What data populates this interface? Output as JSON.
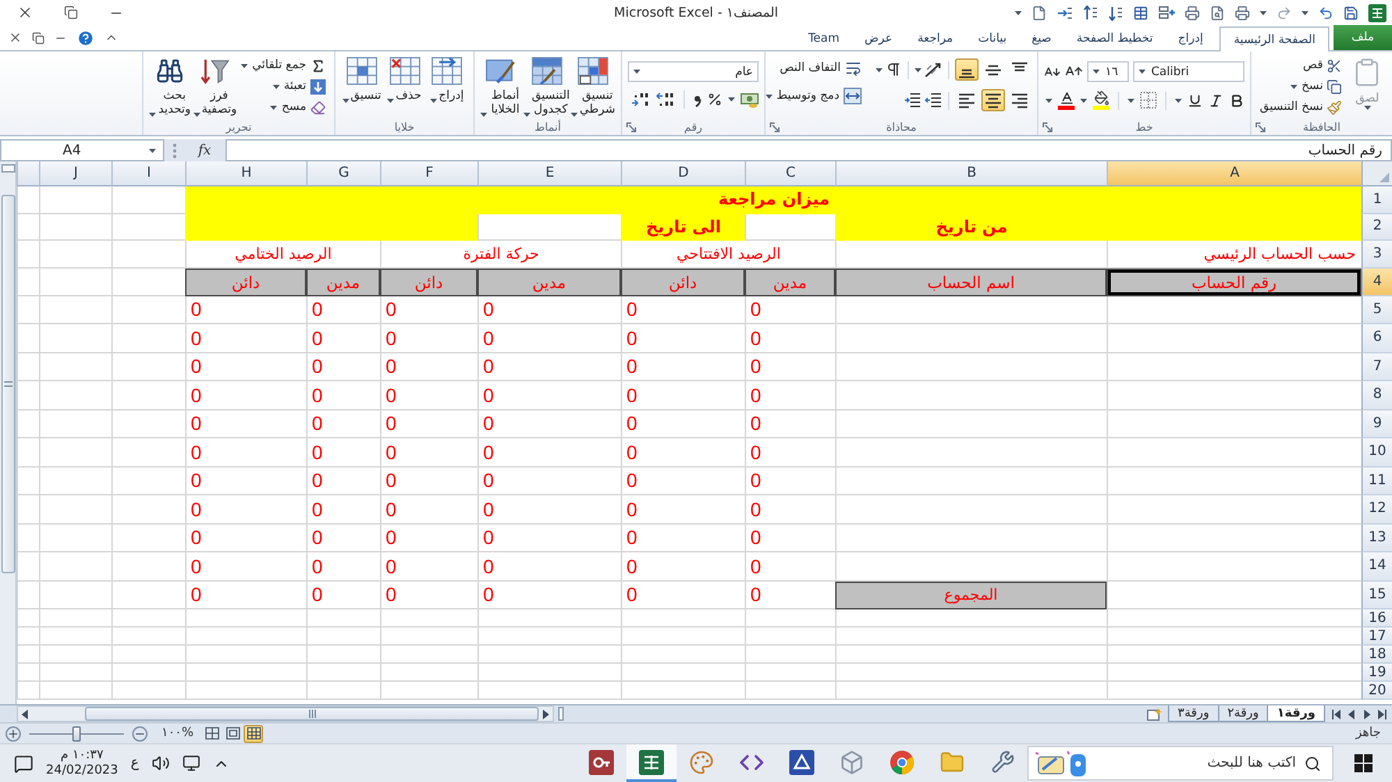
{
  "window": {
    "title": "المصنف١ - Microsoft Excel"
  },
  "ribbon_tabs": [
    {
      "label": "ملف",
      "kind": "file",
      "selected": false
    },
    {
      "label": "الصفحة الرئيسية",
      "kind": "tab",
      "selected": true
    },
    {
      "label": "إدراج",
      "kind": "tab",
      "selected": false
    },
    {
      "label": "تخطيط الصفحة",
      "kind": "tab",
      "selected": false
    },
    {
      "label": "صيغ",
      "kind": "tab",
      "selected": false
    },
    {
      "label": "بيانات",
      "kind": "tab",
      "selected": false
    },
    {
      "label": "مراجعة",
      "kind": "tab",
      "selected": false
    },
    {
      "label": "عرض",
      "kind": "tab",
      "selected": false
    },
    {
      "label": "Team",
      "kind": "tab",
      "selected": false
    }
  ],
  "ribbon": {
    "clipboard": {
      "label": "الحافظة",
      "paste": {
        "label": "لصق",
        "disabled": true
      },
      "cut": "قص",
      "copy": "نسخ",
      "format_painter": "نسخ التنسيق"
    },
    "font": {
      "label": "خط",
      "font_name": "Calibri",
      "font_size": "١٦"
    },
    "alignment": {
      "label": "محاذاة",
      "vertical": [
        {
          "kind": "top",
          "selected": false
        },
        {
          "kind": "middle",
          "selected": false
        },
        {
          "kind": "bottom",
          "selected": true
        }
      ],
      "horizontal": [
        {
          "kind": "right",
          "selected": false
        },
        {
          "kind": "center",
          "selected": true
        },
        {
          "kind": "left",
          "selected": false
        }
      ],
      "wrap_text": "التفاف النص",
      "merge_center": "دمج وتوسيط"
    },
    "number": {
      "label": "رقم",
      "format": "عام"
    },
    "styles": {
      "label": "أنماط",
      "buttons": [
        {
          "label": "تنسيق شرطي",
          "kind": "conditional"
        },
        {
          "label": "التنسيق كجدول",
          "kind": "table"
        },
        {
          "label": "أنماط الخلايا",
          "kind": "cell_styles"
        }
      ]
    },
    "cells": {
      "label": "خلايا",
      "buttons": [
        {
          "label": "إدراج",
          "kind": "insert"
        },
        {
          "label": "حذف",
          "kind": "delete"
        },
        {
          "label": "تنسيق",
          "kind": "format"
        }
      ]
    },
    "editing": {
      "label": "تحرير",
      "autosum": "جمع تلقائي",
      "fill": "تعبئة",
      "clear": "مسح",
      "sort_filter": "فرز وتصفية",
      "find_select": "بحث وتحديد"
    }
  },
  "formula_bar": {
    "name_box": "A4",
    "function_label": "fx",
    "content": "رقم الحساب"
  },
  "sheet": {
    "columns": [
      {
        "label": "A",
        "selected": true
      },
      {
        "label": "B",
        "selected": false
      },
      {
        "label": "C",
        "selected": false
      },
      {
        "label": "D",
        "selected": false
      },
      {
        "label": "E",
        "selected": false
      },
      {
        "label": "F",
        "selected": false
      },
      {
        "label": "G",
        "selected": false
      },
      {
        "label": "H",
        "selected": false
      },
      {
        "label": "I",
        "selected": false
      },
      {
        "label": "J",
        "selected": false
      }
    ],
    "rows": [
      {
        "label": "1",
        "selected": false
      },
      {
        "label": "2",
        "selected": false
      },
      {
        "label": "3",
        "selected": false
      },
      {
        "label": "4",
        "selected": true
      },
      {
        "label": "5",
        "selected": false
      },
      {
        "label": "6",
        "selected": false
      },
      {
        "label": "7",
        "selected": false
      },
      {
        "label": "8",
        "selected": false
      },
      {
        "label": "9",
        "selected": false
      },
      {
        "label": "10",
        "selected": false
      },
      {
        "label": "11",
        "selected": false
      },
      {
        "label": "12",
        "selected": false
      },
      {
        "label": "13",
        "selected": false
      },
      {
        "label": "14",
        "selected": false
      },
      {
        "label": "15",
        "selected": false
      },
      {
        "label": "16",
        "selected": false
      },
      {
        "label": "17",
        "selected": false
      },
      {
        "label": "18",
        "selected": false
      },
      {
        "label": "19",
        "selected": false
      },
      {
        "label": "20",
        "selected": false
      }
    ],
    "title": "ميزان مراجعة",
    "from_label": "من تاريخ",
    "to_label": "الى تاريخ",
    "account_group": "حسب الحساب الرئيسي",
    "column_groups": [
      "الرصيد الافتتاحي",
      "حركة الفترة",
      "الرصيد الختامي"
    ],
    "headers": [
      {
        "text": "رقم الحساب",
        "selected": true
      },
      {
        "text": "اسم الحساب",
        "selected": false
      },
      {
        "text": "مدين",
        "selected": false
      },
      {
        "text": "دائن",
        "selected": false
      },
      {
        "text": "مدين",
        "selected": false
      },
      {
        "text": "دائن",
        "selected": false
      },
      {
        "text": "مدين",
        "selected": false
      },
      {
        "text": "دائن",
        "selected": false
      }
    ],
    "data_rows": [
      {
        "values": [
          "0",
          "0",
          "0",
          "0",
          "0",
          "0"
        ]
      },
      {
        "values": [
          "0",
          "0",
          "0",
          "0",
          "0",
          "0"
        ]
      },
      {
        "values": [
          "0",
          "0",
          "0",
          "0",
          "0",
          "0"
        ]
      },
      {
        "values": [
          "0",
          "0",
          "0",
          "0",
          "0",
          "0"
        ]
      },
      {
        "values": [
          "0",
          "0",
          "0",
          "0",
          "0",
          "0"
        ]
      },
      {
        "values": [
          "0",
          "0",
          "0",
          "0",
          "0",
          "0"
        ]
      },
      {
        "values": [
          "0",
          "0",
          "0",
          "0",
          "0",
          "0"
        ]
      },
      {
        "values": [
          "0",
          "0",
          "0",
          "0",
          "0",
          "0"
        ]
      },
      {
        "values": [
          "0",
          "0",
          "0",
          "0",
          "0",
          "0"
        ]
      },
      {
        "values": [
          "0",
          "0",
          "0",
          "0",
          "0",
          "0"
        ]
      }
    ],
    "total_row": {
      "label": "المجموع",
      "values": [
        "0",
        "0",
        "0",
        "0",
        "0",
        "0"
      ]
    }
  },
  "sheet_tabs": [
    {
      "label": "ورقة١",
      "selected": true
    },
    {
      "label": "ورقة٢",
      "selected": false
    },
    {
      "label": "ورقة٣",
      "selected": false
    }
  ],
  "status_bar": {
    "status": "جاهز",
    "views": [
      {
        "kind": "normal",
        "selected": true
      },
      {
        "kind": "page_layout",
        "selected": false
      },
      {
        "kind": "page_break",
        "selected": false
      }
    ],
    "zoom": "%١٠٠",
    "zoom_slider": {
      "level": 0.5
    }
  },
  "taskbar": {
    "search_placeholder": "اكتب هنا للبحث",
    "apps": [
      {
        "kind": "tools",
        "selected": false
      },
      {
        "kind": "folder",
        "selected": false
      },
      {
        "kind": "browser",
        "selected": false
      },
      {
        "kind": "cube",
        "selected": false
      },
      {
        "kind": "scale",
        "selected": false
      },
      {
        "kind": "code",
        "selected": false
      },
      {
        "kind": "paint",
        "selected": false
      },
      {
        "kind": "spreadsheet",
        "selected": true
      },
      {
        "kind": "database",
        "selected": false
      }
    ],
    "language": "ع",
    "time": "١٠:٣٧ م",
    "date": "24/02/2023"
  }
}
